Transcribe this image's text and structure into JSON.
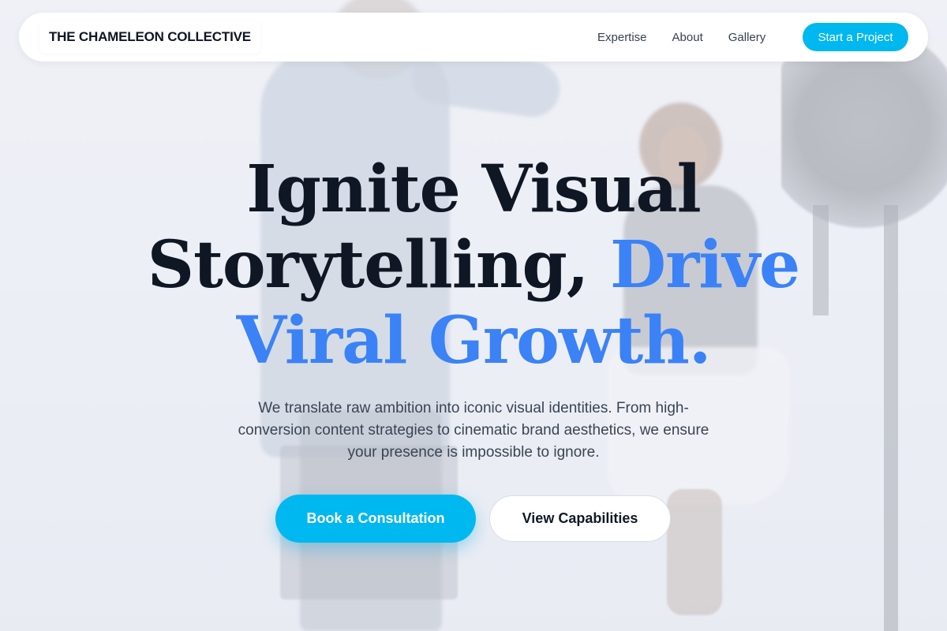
{
  "nav": {
    "brand": "THE CHAMELEON COLLECTIVE",
    "links": [
      {
        "label": "Expertise"
      },
      {
        "label": "About"
      },
      {
        "label": "Gallery"
      }
    ],
    "cta_label": "Start a Project"
  },
  "hero": {
    "title_line1": "Ignite Visual",
    "title_line2_dark": "Storytelling,",
    "title_line2_accent": "Drive",
    "title_line3_accent": "Viral Growth.",
    "subtitle": "We translate raw ambition into iconic visual identities. From high-conversion content strategies to cinematic brand aesthetics, we ensure your presence is impossible to ignore.",
    "primary_button": "Book a Consultation",
    "secondary_button": "View Capabilities"
  },
  "colors": {
    "accent_cyan": "#00b8f0",
    "accent_blue": "#3b82f6",
    "text_dark": "#0f1624"
  }
}
